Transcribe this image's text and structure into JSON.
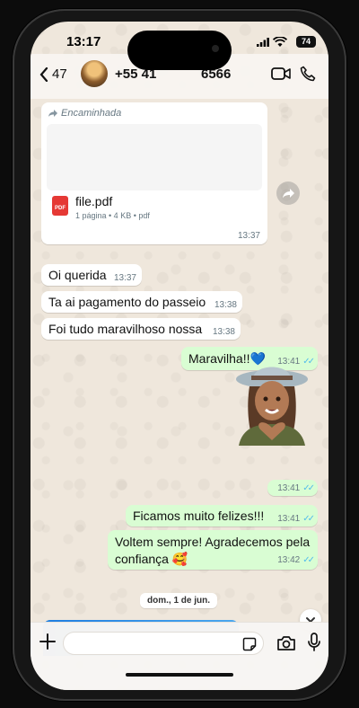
{
  "status_bar": {
    "time": "13:17",
    "battery": "74"
  },
  "header": {
    "back_count": "47",
    "contact_name": "+55 41",
    "contact_tail": "6566"
  },
  "messages": {
    "forwarded_label": "Encaminhada",
    "pdf_file_name": "file.pdf",
    "pdf_meta": "1 página • 4 KB • pdf",
    "pdf_time": "13:37",
    "m1_text": "Oi querida",
    "m1_time": "13:37",
    "m2_text": "Ta ai pagamento do passeio",
    "m2_time": "13:38",
    "m3_text": "Foi tudo maravilhoso nossa",
    "m3_time": "13:38",
    "m4_text": "Maravilha!!💙",
    "m4_time": "13:41",
    "sticker_time": "13:41",
    "m5_text": "Ficamos muito felizes!!!",
    "m5_time": "13:41",
    "m6_line1": "Voltem sempre! Agradecemos pela",
    "m6_line2": "confiança 🥰",
    "m6_time": "13:42"
  },
  "date_divider": "dom., 1 de jun.",
  "composer": {
    "placeholder": ""
  },
  "colors": {
    "incoming": "#ffffff",
    "outgoing": "#d9fdd3",
    "read_ticks": "#53bdeb",
    "wallpaper": "#efe7dc"
  }
}
